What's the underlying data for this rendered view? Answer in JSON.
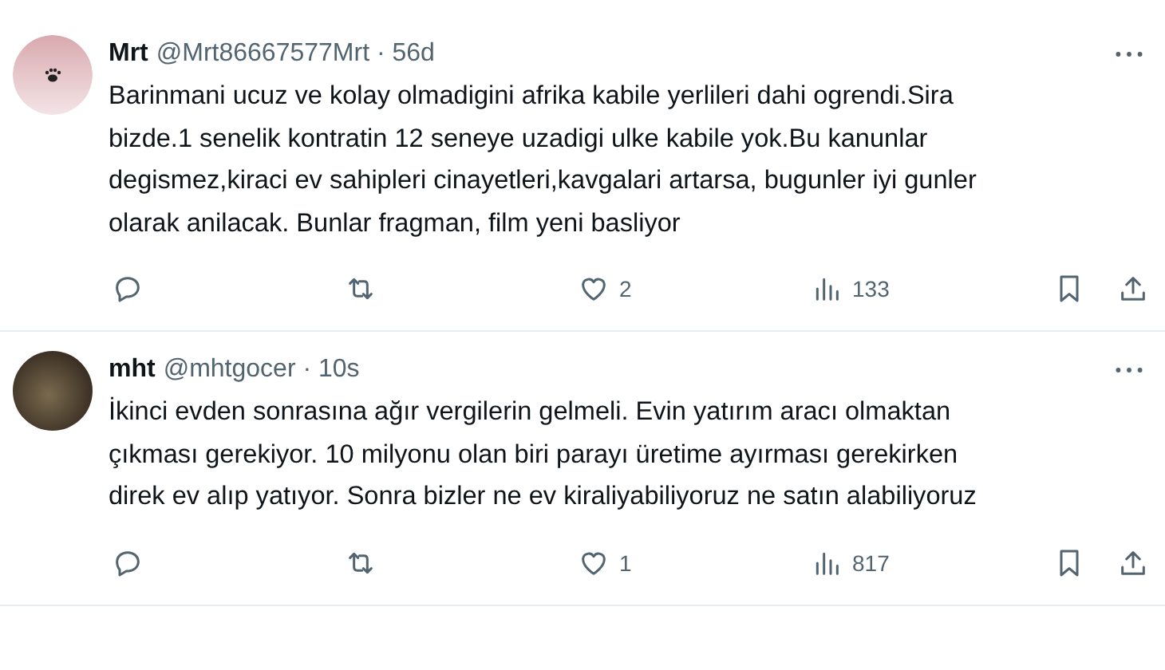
{
  "tweets": [
    {
      "name": "Mrt",
      "handle": "@Mrt86667577Mrt",
      "separator": "·",
      "time": "56d",
      "avatar": {
        "kind": "paw"
      },
      "text": "Barinmani ucuz ve kolay olmadigini afrika kabile yerlileri dahi ogrendi.Sira\nbizde.1 senelik kontratin 12 seneye uzadigi ulke kabile yok.Bu kanunlar\ndegismez,kiraci ev sahipleri cinayetleri,kavgalari artarsa, bugunler iyi gunler\nolarak anilacak. Bunlar fragman, film yeni basliyor",
      "likes": "2",
      "views": "133"
    },
    {
      "name": "mht",
      "handle": "@mhtgocer",
      "separator": "·",
      "time": "10s",
      "avatar": {
        "kind": "photo"
      },
      "text": "İkinci evden sonrasına ağır vergilerin gelmeli. Evin yatırım aracı olmaktan\nçıkması gerekiyor. 10 milyonu olan biri parayı üretime ayırması gerekirken\ndirek ev alıp yatıyor. Sonra bizler ne ev kiraliyabiliyoruz ne satın alabiliyoruz",
      "likes": "1",
      "views": "817"
    }
  ]
}
